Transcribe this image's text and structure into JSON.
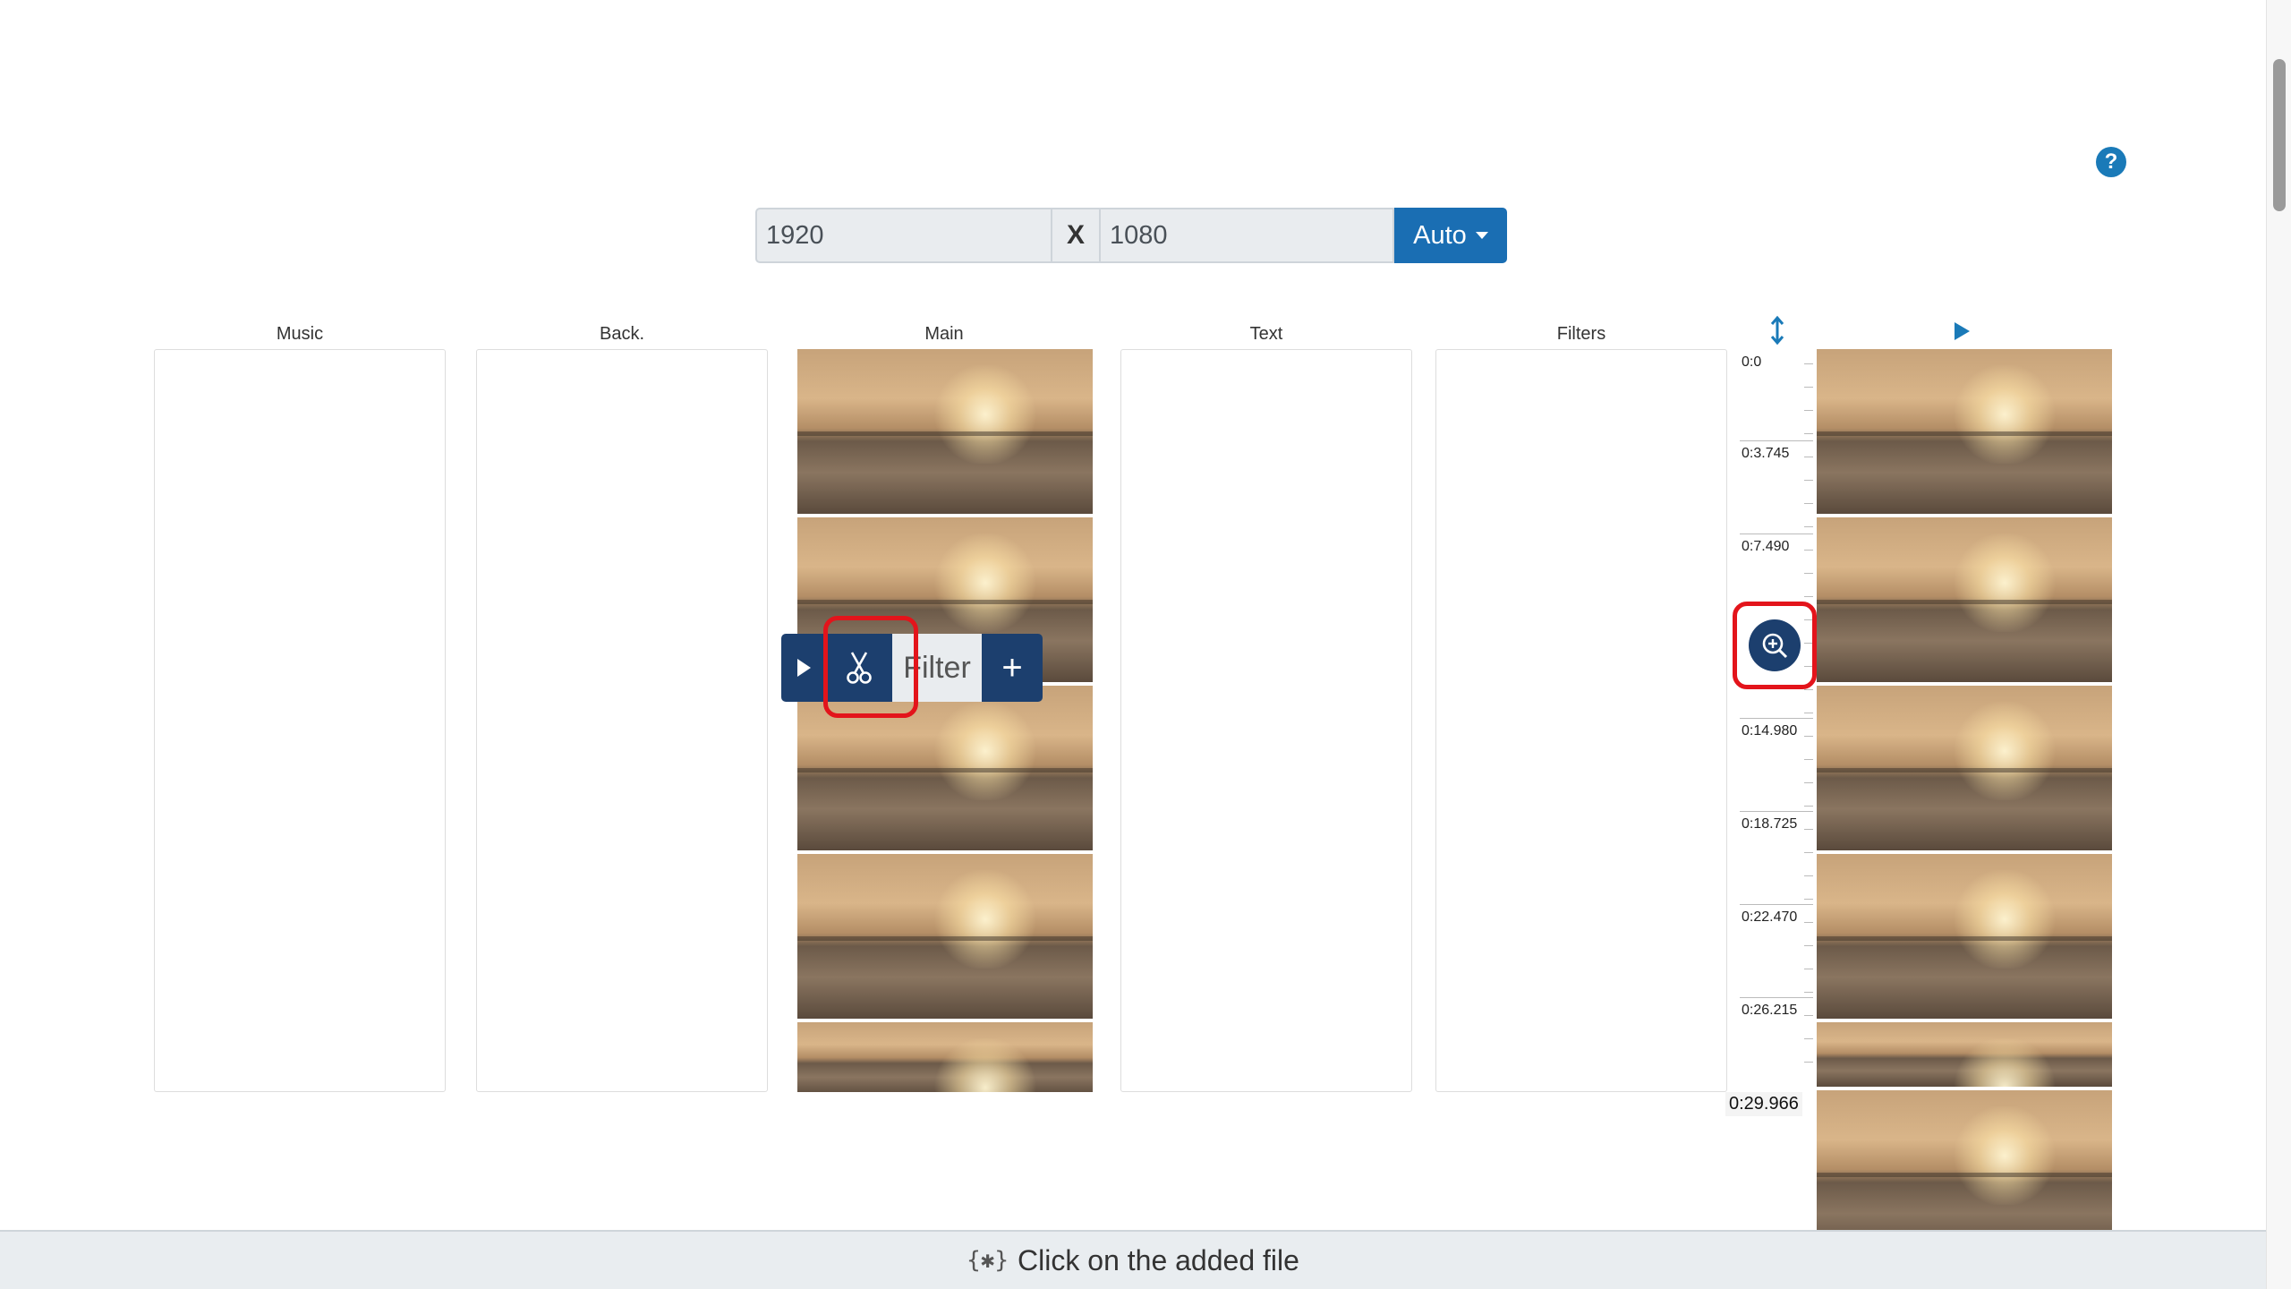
{
  "help": {
    "label": "?"
  },
  "resolution": {
    "width": "1920",
    "separator": "X",
    "height": "1080",
    "mode": "Auto"
  },
  "columns": [
    {
      "label": "Music"
    },
    {
      "label": "Back."
    },
    {
      "label": "Main"
    },
    {
      "label": "Text"
    },
    {
      "label": "Filters"
    }
  ],
  "clip_toolbar": {
    "filter_label": "Filter",
    "add_label": "+"
  },
  "timeline": {
    "ticks": [
      "0:0",
      "0:3.745",
      "0:7.490",
      "0:14.980",
      "0:18.725",
      "0:22.470",
      "0:26.215"
    ],
    "end_time": "0:29.966"
  },
  "hint": {
    "icon": "{✱}",
    "text": "Click on the added file"
  },
  "colors": {
    "accent": "#1a6eb3",
    "dark_button": "#1c3f6e",
    "highlight_ring": "#e3141b"
  }
}
